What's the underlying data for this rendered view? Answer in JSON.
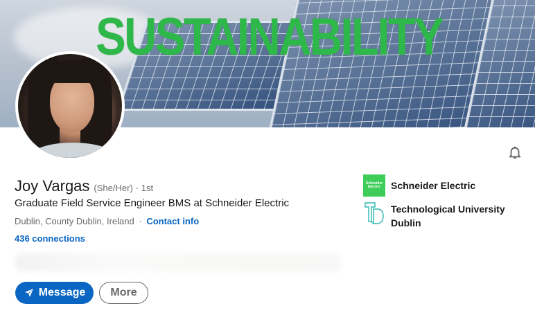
{
  "banner": {
    "text": "SUSTAINABILITY",
    "text_color": "#2fb84a"
  },
  "profile": {
    "name": "Joy Vargas",
    "pronouns": "(She/Her)",
    "degree": "· 1st",
    "headline": "Graduate Field Service Engineer BMS at Schneider Electric",
    "location": "Dublin, County Dublin, Ireland",
    "separator": "·",
    "contact_info": "Contact info",
    "connections": "436 connections"
  },
  "actions": {
    "message_label": "Message",
    "more_label": "More",
    "notify_icon": "bell-icon",
    "message_icon": "send-icon"
  },
  "organizations": [
    {
      "name": "Schneider Electric",
      "logo_text": "Schneider Electric",
      "logo_color": "#3dcd58"
    },
    {
      "name": "Technological University Dublin",
      "logo_color": "#2bb7b0"
    }
  ],
  "colors": {
    "link": "#0a66c2",
    "primary_button": "#0a66c2"
  }
}
